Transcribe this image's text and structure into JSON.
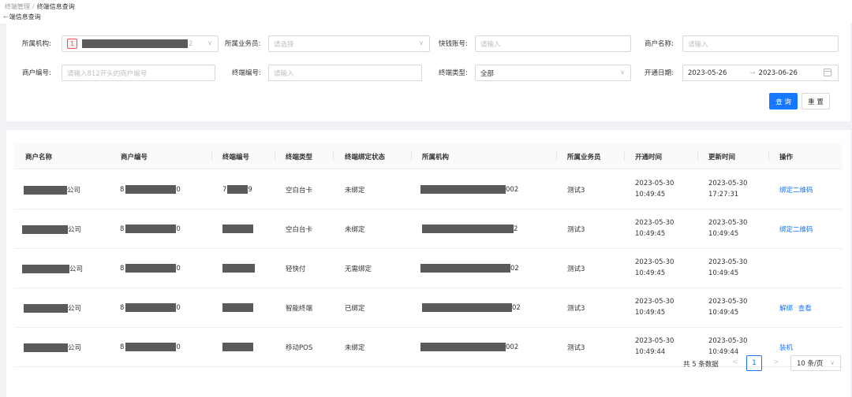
{
  "breadcrumb": {
    "parent": "终端管理",
    "current": "终端信息查询"
  },
  "page_title": "端信息查询",
  "filters": {
    "org": {
      "label": "所属机构:",
      "tag": "1",
      "suffix": "2"
    },
    "salesman": {
      "label": "所属业务员:",
      "placeholder": "请选择"
    },
    "kq_account": {
      "label": "快钱账号:",
      "placeholder": "请输入"
    },
    "merchant_name": {
      "label": "商户名称:",
      "placeholder": "请输入"
    },
    "merchant_no": {
      "label": "商户编号:",
      "placeholder": "请输入812开头的商户编号"
    },
    "terminal_no": {
      "label": "终端编号:",
      "placeholder": "请输入"
    },
    "terminal_type": {
      "label": "终端类型:",
      "value": "全部"
    },
    "open_date": {
      "label": "开通日期:",
      "start": "2023-05-26",
      "sep": "→",
      "end": "2023-06-26"
    },
    "query_label": "查 询",
    "reset_label": "重 置"
  },
  "table": {
    "columns": [
      "商户名称",
      "商户编号",
      "终端编号",
      "终端类型",
      "终端绑定状态",
      "所属机构",
      "所属业务员",
      "开通时间",
      "更新时间",
      "操作"
    ],
    "rows": [
      {
        "merchant_suffix": "公司",
        "merchant_no_prefix": "8",
        "merchant_no_suffix": "0",
        "terminal_prefix": "7",
        "terminal_suffix": "9",
        "type": "空白台卡",
        "status": "未绑定",
        "org_suffix": "002",
        "salesman": "测试3",
        "open_date": "2023-05-30",
        "open_time": "10:49:45",
        "upd_date": "2023-05-30",
        "upd_time": "17:27:31",
        "actions": [
          "绑定二维码"
        ]
      },
      {
        "merchant_suffix": "公司",
        "merchant_no_prefix": "8",
        "merchant_no_suffix": "0",
        "terminal_prefix": "",
        "terminal_suffix": "",
        "type": "空白台卡",
        "status": "未绑定",
        "org_suffix": "2",
        "salesman": "测试3",
        "open_date": "2023-05-30",
        "open_time": "10:49:45",
        "upd_date": "2023-05-30",
        "upd_time": "10:49:45",
        "actions": [
          "绑定二维码"
        ]
      },
      {
        "merchant_suffix": "公司",
        "merchant_no_prefix": "8",
        "merchant_no_suffix": "0",
        "terminal_prefix": "",
        "terminal_suffix": "",
        "type": "轻快付",
        "status": "无需绑定",
        "org_suffix": "02",
        "salesman": "测试3",
        "open_date": "2023-05-30",
        "open_time": "10:49:45",
        "upd_date": "2023-05-30",
        "upd_time": "10:49:45",
        "actions": []
      },
      {
        "merchant_suffix": "公司",
        "merchant_no_prefix": "8",
        "merchant_no_suffix": "0",
        "terminal_prefix": "",
        "terminal_suffix": "",
        "type": "智能终端",
        "status": "已绑定",
        "org_suffix": "02",
        "salesman": "测试3",
        "open_date": "2023-05-30",
        "open_time": "10:49:45",
        "upd_date": "2023-05-30",
        "upd_time": "10:49:45",
        "actions": [
          "解绑",
          "查看"
        ]
      },
      {
        "merchant_suffix": "公司",
        "merchant_no_prefix": "8",
        "merchant_no_suffix": "0",
        "terminal_prefix": "",
        "terminal_suffix": "",
        "type": "移动POS",
        "status": "未绑定",
        "org_suffix": "002",
        "salesman": "测试3",
        "open_date": "2023-05-30",
        "open_time": "10:49:44",
        "upd_date": "2023-05-30",
        "upd_time": "10:49:44",
        "actions": [
          "装机"
        ]
      }
    ]
  },
  "pagination": {
    "total_text": "共 5 条数据",
    "prev": "<",
    "current": "1",
    "next": ">",
    "page_size": "10 条/页"
  }
}
